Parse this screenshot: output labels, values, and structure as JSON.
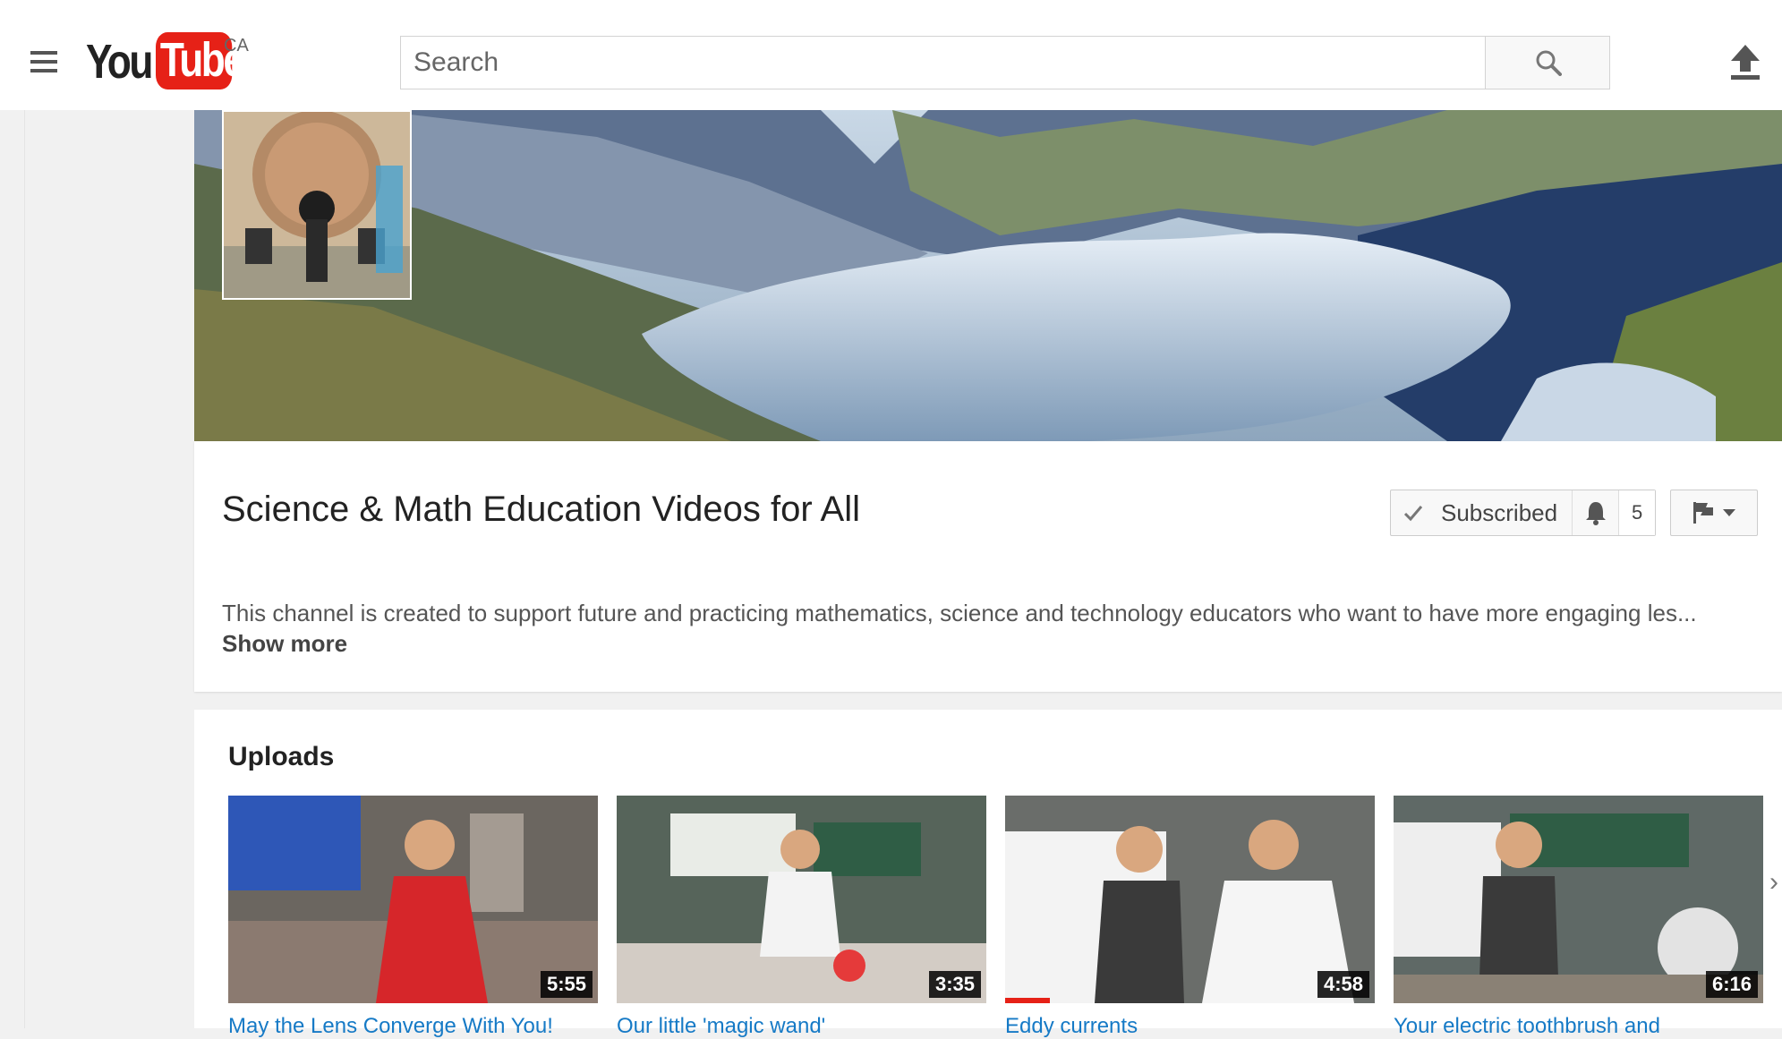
{
  "header": {
    "logo_you": "You",
    "logo_tube": "Tube",
    "country_code": "CA",
    "search_placeholder": "Search",
    "menu_icon": "hamburger-icon",
    "search_icon": "search-icon",
    "upload_icon": "upload-icon"
  },
  "channel": {
    "title": "Science & Math Education Videos for All",
    "subscribe_label": "Subscribed",
    "notification_count": "5",
    "description": "This channel is created to support future and practicing mathematics, science and technology educators who want to have more engaging les...",
    "show_more": "Show more"
  },
  "uploads": {
    "heading": "Uploads",
    "videos": [
      {
        "title": "May the Lens Converge With You!",
        "duration": "5:55"
      },
      {
        "title": "Our little 'magic wand'",
        "duration": "3:35"
      },
      {
        "title": "Eddy currents",
        "duration": "4:58",
        "watched": 0.12
      },
      {
        "title": "Your electric toothbrush and",
        "duration": "6:16"
      }
    ]
  },
  "colors": {
    "brand_red": "#e62117",
    "link_blue": "#167ac6"
  }
}
